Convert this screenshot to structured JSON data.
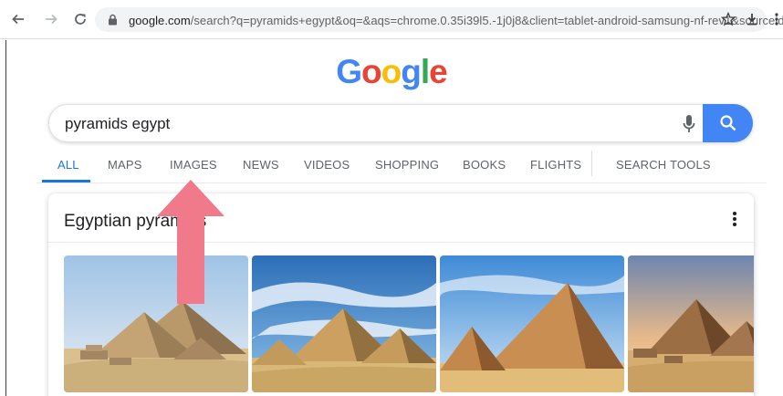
{
  "browser": {
    "url_domain": "google.com",
    "url_rest": "/search?q=pyramids+egypt&oq=&aqs=chrome.0.35i39l5.-1j0j8&client=tablet-android-samsung-nf-rev1&sourceid"
  },
  "logo": {
    "letters": [
      "G",
      "o",
      "o",
      "g",
      "l",
      "e"
    ],
    "colors": [
      "#4285f4",
      "#ea4335",
      "#fbbc05",
      "#4285f4",
      "#34a853",
      "#ea4335"
    ]
  },
  "search": {
    "query": "pyramids egypt"
  },
  "tabs": [
    {
      "label": "ALL"
    },
    {
      "label": "MAPS"
    },
    {
      "label": "IMAGES"
    },
    {
      "label": "NEWS"
    },
    {
      "label": "VIDEOS"
    },
    {
      "label": "SHOPPING"
    },
    {
      "label": "BOOKS"
    },
    {
      "label": "FLIGHTS"
    },
    {
      "label": "SEARCH TOOLS"
    }
  ],
  "card": {
    "title": "Egyptian pyramids",
    "thumbnails": [
      "pyramids-image",
      "pyramids-image",
      "pyramids-image",
      "pyramids-image"
    ]
  },
  "colors": {
    "accent": "#1a73e8",
    "search_button": "#4285f4",
    "annotation_arrow": "#f07a8a"
  }
}
